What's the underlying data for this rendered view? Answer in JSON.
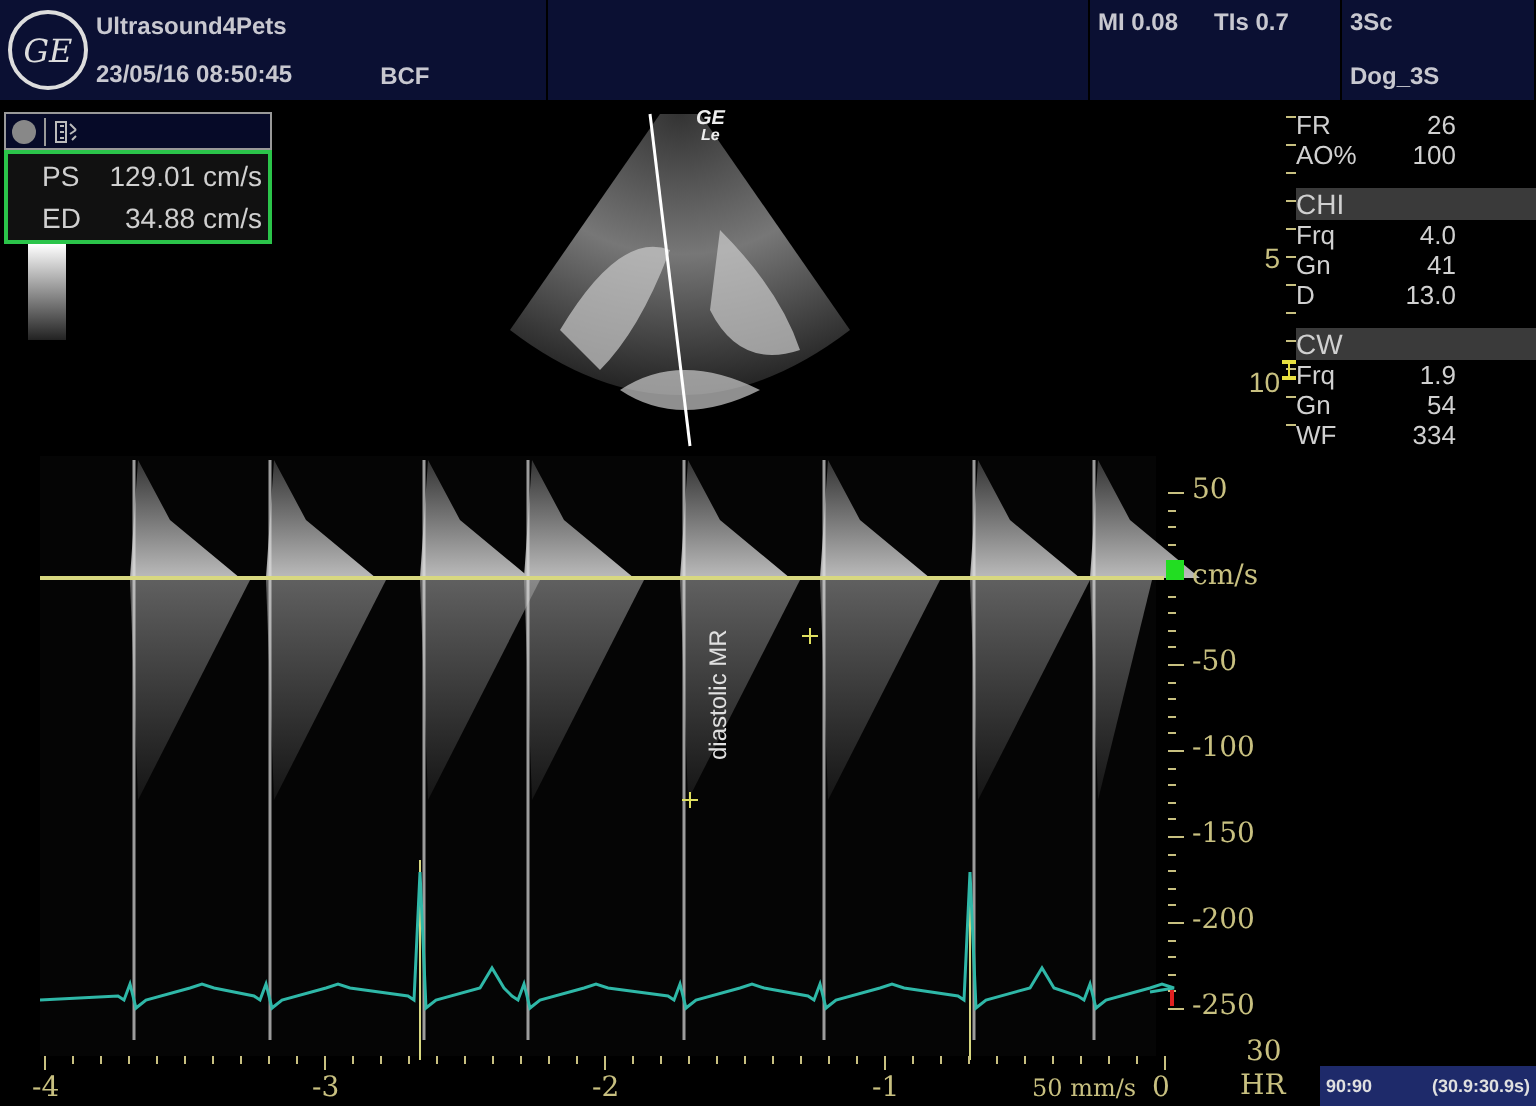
{
  "header": {
    "logo": "GE",
    "site": "Ultrasound4Pets",
    "datetime": "23/05/16 08:50:45",
    "operator": "BCF",
    "mi": "MI 0.08",
    "tis": "TIs 0.7",
    "probe": "3Sc",
    "preset": "Dog_3S"
  },
  "measurements": [
    {
      "label": "PS",
      "value": "129.01 cm/s"
    },
    {
      "label": "ED",
      "value": "34.88 cm/s"
    }
  ],
  "image_label": {
    "line1": "GE",
    "line2": "Le"
  },
  "depth_scale": [
    "5",
    "10"
  ],
  "parameters": [
    {
      "kind": "row",
      "label": "FR",
      "value": "26"
    },
    {
      "kind": "row",
      "label": "AO%",
      "value": "100"
    },
    {
      "kind": "header",
      "label": "CHI"
    },
    {
      "kind": "row",
      "label": "Frq",
      "value": "4.0"
    },
    {
      "kind": "row",
      "label": "Gn",
      "value": "41"
    },
    {
      "kind": "row",
      "label": "D",
      "value": "13.0"
    },
    {
      "kind": "header",
      "label": "CW"
    },
    {
      "kind": "row",
      "label": "Frq",
      "value": "1.9"
    },
    {
      "kind": "row",
      "label": "Gn",
      "value": "54"
    },
    {
      "kind": "row",
      "label": "WF",
      "value": "334"
    }
  ],
  "spectrum": {
    "annotation": "diastolic MR",
    "velocity_ticks": [
      "50",
      "cm/s",
      "-50",
      "-100",
      "-150",
      "-200",
      "-250"
    ],
    "time_ticks": [
      "-4",
      "-3",
      "-2",
      "-1",
      "0"
    ],
    "sweep": "50 mm/s"
  },
  "hr": {
    "value": "30",
    "label": "HR",
    "range": "90:90",
    "time": "(30.9:30.9s)"
  }
}
